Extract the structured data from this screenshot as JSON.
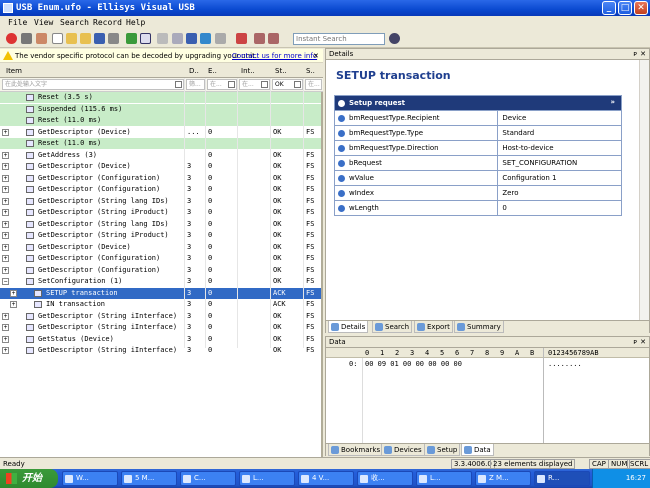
{
  "window": {
    "title": "USB Enum.ufo - Ellisys Visual USB"
  },
  "menu": [
    "File",
    "View",
    "Search",
    "Record",
    "Help"
  ],
  "toolbar": {
    "search_placeholder": "Instant Search"
  },
  "infobar": {
    "message": "The vendor specific protocol can be decoded by upgrading your unit.",
    "link": "Contact us for more info",
    "close": "✕"
  },
  "tree": {
    "columns": [
      "Item",
      "D..",
      "E..",
      "Int..",
      "St..",
      "S.."
    ],
    "filters": [
      "在此处输入文字",
      "筛...",
      "在...",
      "在...",
      "OK",
      "在..."
    ],
    "rows": [
      {
        "name": "Reset (3.5 s)",
        "d": "",
        "e": "",
        "st": "",
        "s": "",
        "green": true,
        "indent": 1
      },
      {
        "name": "Suspended (115.6 ms)",
        "d": "",
        "e": "",
        "st": "",
        "s": "",
        "green": true,
        "indent": 1
      },
      {
        "name": "Reset (11.0 ms)",
        "d": "",
        "e": "",
        "st": "",
        "s": "",
        "green": true,
        "indent": 1
      },
      {
        "name": "GetDescriptor (Device)",
        "d": "...",
        "e": "0",
        "st": "OK",
        "s": "FS",
        "expander": "+",
        "indent": 1
      },
      {
        "name": "Reset (11.0 ms)",
        "d": "",
        "e": "",
        "st": "",
        "s": "",
        "green": true,
        "indent": 1
      },
      {
        "name": "GetAddress (3)",
        "d": "",
        "e": "0",
        "st": "OK",
        "s": "FS",
        "expander": "+",
        "indent": 1
      },
      {
        "name": "GetDescriptor (Device)",
        "d": "3",
        "e": "0",
        "st": "OK",
        "s": "FS",
        "expander": "+",
        "indent": 1
      },
      {
        "name": "GetDescriptor (Configuration)",
        "d": "3",
        "e": "0",
        "st": "OK",
        "s": "FS",
        "expander": "+",
        "indent": 1
      },
      {
        "name": "GetDescriptor (Configuration)",
        "d": "3",
        "e": "0",
        "st": "OK",
        "s": "FS",
        "expander": "+",
        "indent": 1
      },
      {
        "name": "GetDescriptor (String lang IDs)",
        "d": "3",
        "e": "0",
        "st": "OK",
        "s": "FS",
        "expander": "+",
        "indent": 1
      },
      {
        "name": "GetDescriptor (String iProduct)",
        "d": "3",
        "e": "0",
        "st": "OK",
        "s": "FS",
        "expander": "+",
        "indent": 1
      },
      {
        "name": "GetDescriptor (String lang IDs)",
        "d": "3",
        "e": "0",
        "st": "OK",
        "s": "FS",
        "expander": "+",
        "indent": 1
      },
      {
        "name": "GetDescriptor (String iProduct)",
        "d": "3",
        "e": "0",
        "st": "OK",
        "s": "FS",
        "expander": "+",
        "indent": 1
      },
      {
        "name": "GetDescriptor (Device)",
        "d": "3",
        "e": "0",
        "st": "OK",
        "s": "FS",
        "expander": "+",
        "indent": 1
      },
      {
        "name": "GetDescriptor (Configuration)",
        "d": "3",
        "e": "0",
        "st": "OK",
        "s": "FS",
        "expander": "+",
        "indent": 1
      },
      {
        "name": "GetDescriptor (Configuration)",
        "d": "3",
        "e": "0",
        "st": "OK",
        "s": "FS",
        "expander": "+",
        "indent": 1
      },
      {
        "name": "SetConfiguration (1)",
        "d": "3",
        "e": "0",
        "st": "OK",
        "s": "FS",
        "expander": "−",
        "indent": 1
      },
      {
        "name": "SETUP transaction",
        "d": "3",
        "e": "0",
        "st": "ACK",
        "s": "FS",
        "expander": "+",
        "indent": 2,
        "selected": true
      },
      {
        "name": "IN transaction",
        "d": "3",
        "e": "0",
        "st": "ACK",
        "s": "FS",
        "expander": "+",
        "indent": 2
      },
      {
        "name": "GetDescriptor (String iInterface)",
        "d": "3",
        "e": "0",
        "st": "OK",
        "s": "FS",
        "expander": "+",
        "indent": 1
      },
      {
        "name": "GetDescriptor (String iInterface)",
        "d": "3",
        "e": "0",
        "st": "OK",
        "s": "FS",
        "expander": "+",
        "indent": 1
      },
      {
        "name": "GetStatus (Device)",
        "d": "3",
        "e": "0",
        "st": "OK",
        "s": "FS",
        "expander": "+",
        "indent": 1
      },
      {
        "name": "GetDescriptor (String iInterface)",
        "d": "3",
        "e": "0",
        "st": "OK",
        "s": "FS",
        "expander": "+",
        "indent": 1
      }
    ]
  },
  "details": {
    "pane_title": "Details",
    "title": "SETUP transaction",
    "group": "Setup request",
    "fields": [
      {
        "k": "bmRequestType.Recipient",
        "v": "Device"
      },
      {
        "k": "bmRequestType.Type",
        "v": "Standard"
      },
      {
        "k": "bmRequestType.Direction",
        "v": "Host-to-device"
      },
      {
        "k": "bRequest",
        "v": "SET_CONFIGURATION"
      },
      {
        "k": "wValue",
        "v": "Configuration 1"
      },
      {
        "k": "wIndex",
        "v": "Zero"
      },
      {
        "k": "wLength",
        "v": "0"
      }
    ],
    "tabs": [
      "Details",
      "Search",
      "Export",
      "Summary"
    ]
  },
  "data_pane": {
    "pane_title": "Data",
    "hex_header": [
      "0",
      "1",
      "2",
      "3",
      "4",
      "5",
      "6",
      "7",
      "8",
      "9",
      "A",
      "B"
    ],
    "ascii_header": "0123456789AB",
    "offset": "0:",
    "hex_row": "00 09 01 00 00 00 00 00",
    "ascii_row": "........",
    "tabs": [
      "Bookmarks",
      "Devices",
      "Setup",
      "Data"
    ]
  },
  "status": {
    "left": "Ready",
    "version": "3.3.4006.0",
    "count": "23 elements displayed",
    "caps": "CAP",
    "num": "NUM",
    "scrl": "SCRL"
  },
  "taskbar": {
    "start": "开始",
    "tasks": [
      "W...",
      "5 M...",
      "C...",
      "L...",
      "4 V...",
      "收...",
      "L...",
      "Z M...",
      "R..."
    ],
    "clock": "16:27"
  },
  "colors": {
    "title": "#0a49d0",
    "selection": "#316ac5",
    "green_row": "#c8ecc8",
    "accent": "#1f3a7a"
  }
}
